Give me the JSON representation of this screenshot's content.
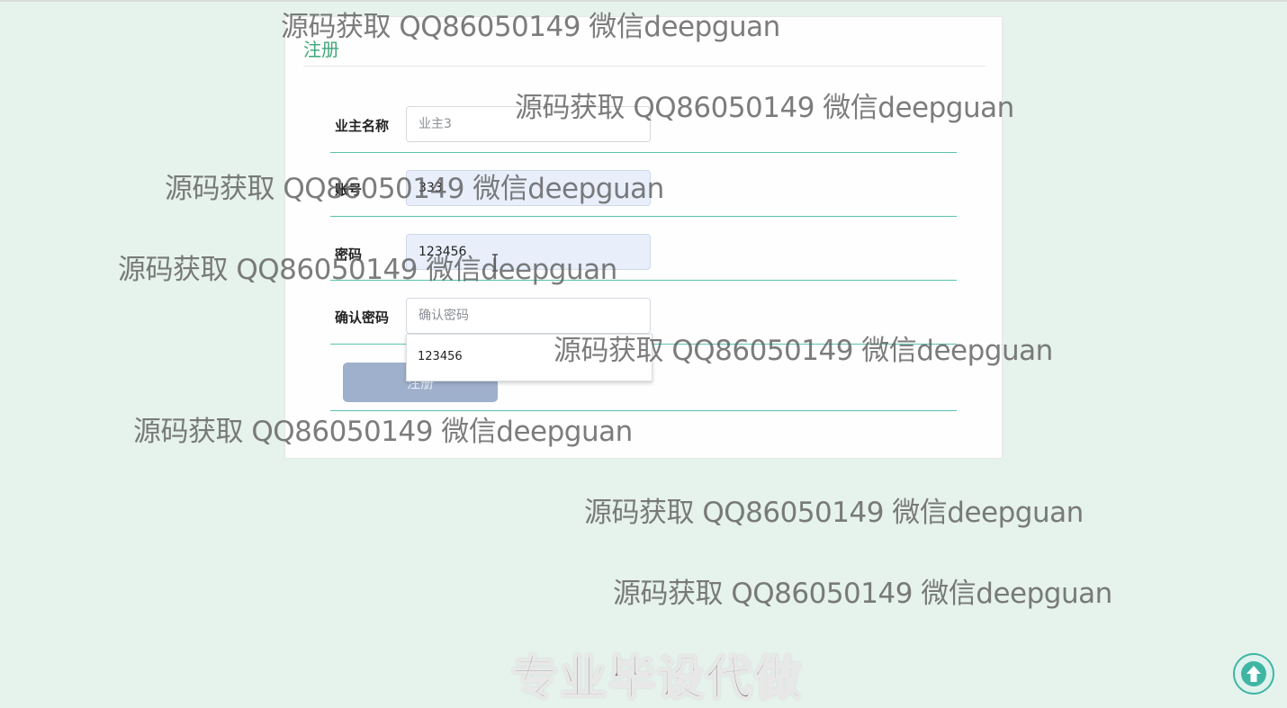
{
  "card": {
    "title": "注册"
  },
  "form": {
    "owner_name": {
      "label": "业主名称",
      "placeholder": "业主3",
      "value": ""
    },
    "account": {
      "label": "账号",
      "value": "333"
    },
    "password": {
      "label": "密码",
      "value": "123456"
    },
    "confirm_password": {
      "label": "确认密码",
      "placeholder": "确认密码",
      "value": ""
    },
    "submit_label": "注册"
  },
  "autocomplete": {
    "suggestion": "123456"
  },
  "watermark": {
    "text": "源码获取 QQ86050149 微信deepguan"
  },
  "footer": {
    "text": "专业毕设代做"
  },
  "back_to_top": {
    "icon": "arrow-up-icon",
    "color": "#3fb6a4"
  },
  "colors": {
    "accent": "#3fa77a",
    "row_line": "#5cc2b2",
    "button": "#9fb0cc",
    "background": "#e6f2ec"
  }
}
